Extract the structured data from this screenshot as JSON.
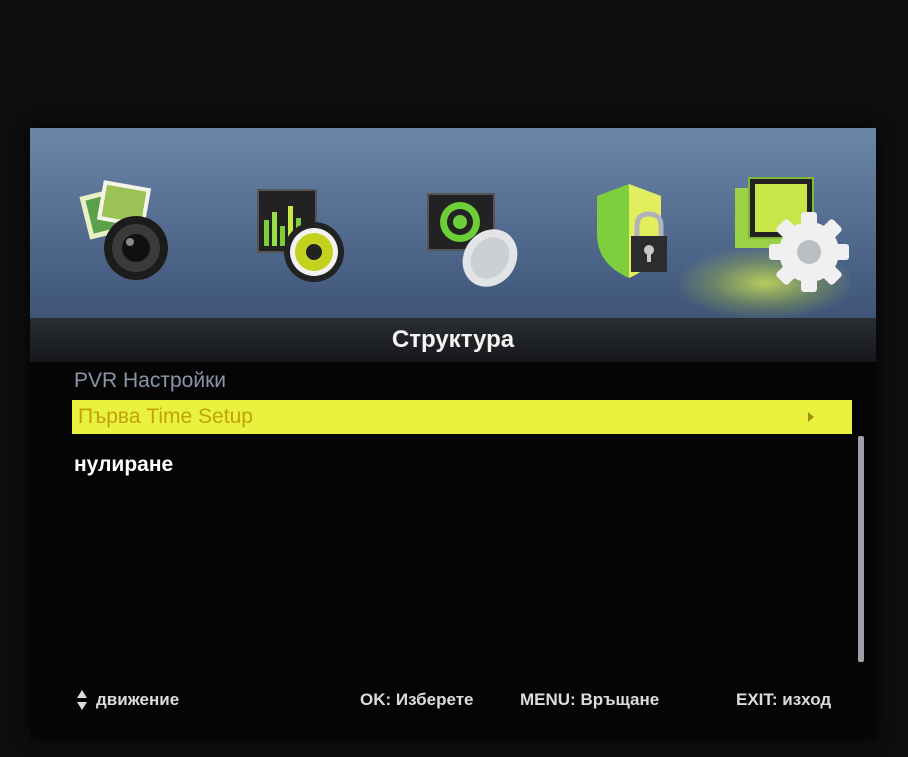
{
  "screen_title": "Структура",
  "top_icons": [
    {
      "name": "photo-camera-icon",
      "label": ""
    },
    {
      "name": "music-speaker-icon",
      "label": ""
    },
    {
      "name": "satellite-dish-icon",
      "label": ""
    },
    {
      "name": "lock-shield-icon",
      "label": ""
    },
    {
      "name": "settings-gear-icon",
      "label": ""
    }
  ],
  "selected_tab": "settings-gear-icon",
  "menu": {
    "items": [
      {
        "label": "PVR Настройки",
        "state": "disabled"
      },
      {
        "label": "Първа Time Setup",
        "state": "selected"
      },
      {
        "label": "нулиране",
        "state": "normal"
      }
    ]
  },
  "footer": {
    "move": "движение",
    "ok": "OK: Изберете",
    "menu": "MENU: Връщане",
    "exit": "EXIT: изход"
  },
  "colors": {
    "highlight": "#e9f23f",
    "highlight_text": "#c3a10a",
    "disabled_text": "#8b95a8",
    "icon_bar": "#566f93"
  }
}
